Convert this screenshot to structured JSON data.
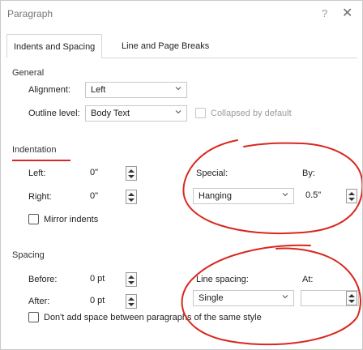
{
  "window": {
    "title": "Paragraph",
    "help": "?",
    "close": "✕"
  },
  "tabs": [
    {
      "label": "Indents and Spacing"
    },
    {
      "label": "Line and Page Breaks"
    }
  ],
  "general": {
    "heading": "General",
    "alignment_label": "Alignment:",
    "alignment_value": "Left",
    "outline_label": "Outline level:",
    "outline_value": "Body Text",
    "collapsed_label": "Collapsed by default"
  },
  "indentation": {
    "heading": "Indentation",
    "left_label": "Left:",
    "left_value": "0\"",
    "right_label": "Right:",
    "right_value": "0\"",
    "special_label": "Special:",
    "special_value": "Hanging",
    "by_label": "By:",
    "by_value": "0.5\"",
    "mirror_label": "Mirror indents"
  },
  "spacing": {
    "heading": "Spacing",
    "before_label": "Before:",
    "before_value": "0 pt",
    "after_label": "After:",
    "after_value": "0 pt",
    "line_spacing_label": "Line spacing:",
    "line_spacing_value": "Single",
    "at_label": "At:",
    "at_value": "",
    "dont_add_label": "Don't add space between paragraphs of the same style"
  },
  "colors": {
    "annotation": "#d9281f",
    "border": "#c8c8c8"
  }
}
